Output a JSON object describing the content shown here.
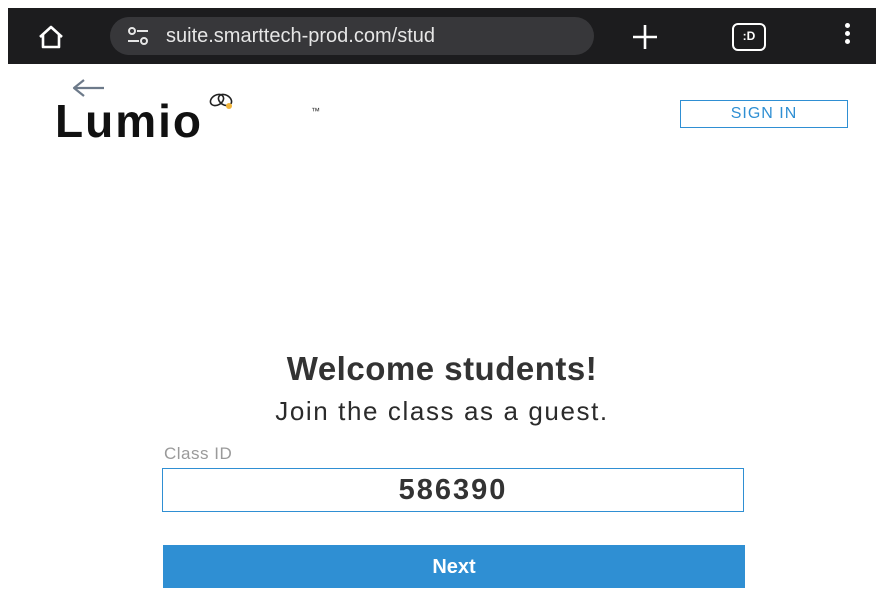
{
  "browser": {
    "url": "suite.smarttech-prod.com/stud",
    "tabs_label": ":D",
    "icons": {
      "home": "home-icon",
      "site_info": "site-info-icon",
      "new_tab": "plus-icon",
      "tabs": "tabs-icon",
      "menu": "more-vert-icon"
    }
  },
  "header": {
    "logo_text": "Lumio",
    "logo_tm": "™",
    "sign_in_label": "SIGN IN",
    "back_icon": "back-arrow-icon"
  },
  "main": {
    "title": "Welcome students!",
    "subtitle": "Join the class as a guest.",
    "class_id_label": "Class ID",
    "class_id_value": "586390",
    "next_label": "Next"
  },
  "colors": {
    "accent": "#2f8fd3",
    "browser_bar": "#1c1c1e",
    "url_pill": "#37373a"
  }
}
